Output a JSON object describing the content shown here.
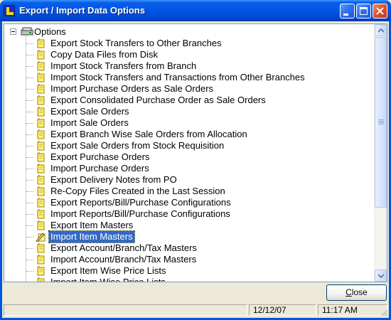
{
  "window": {
    "title": "Export / Import Data Options"
  },
  "tree": {
    "root_label": "Options",
    "items": [
      {
        "label": "Export Stock Transfers to Other Branches"
      },
      {
        "label": "Copy Data Files from Disk"
      },
      {
        "label": "Import Stock Transfers from Branch"
      },
      {
        "label": "Import Stock Transfers and Transactions from Other Branches"
      },
      {
        "label": "Import Purchase Orders as Sale Orders"
      },
      {
        "label": "Export Consolidated Purchase Order as Sale Orders"
      },
      {
        "label": "Export Sale Orders"
      },
      {
        "label": "Import Sale Orders"
      },
      {
        "label": "Export Branch Wise Sale Orders from Allocation"
      },
      {
        "label": "Export Sale Orders from Stock Requisition"
      },
      {
        "label": "Export Purchase Orders"
      },
      {
        "label": "Import Purchase Orders"
      },
      {
        "label": "Export Delivery Notes from PO"
      },
      {
        "label": "Re-Copy Files Created in the Last Session"
      },
      {
        "label": "Export Reports/Bill/Purchase Configurations"
      },
      {
        "label": "Import Reports/Bill/Purchase Configurations"
      },
      {
        "label": "Export Item Masters"
      },
      {
        "label": "Import Item Masters",
        "selected": true
      },
      {
        "label": "Export Account/Branch/Tax Masters"
      },
      {
        "label": "Import Account/Branch/Tax Masters"
      },
      {
        "label": "Export Item Wise Price Lists"
      },
      {
        "label": "Import Item Wise Price Lists"
      }
    ]
  },
  "buttons": {
    "close_accel": "C",
    "close_rest": "lose"
  },
  "status": {
    "panel1": "",
    "date": "12/12/07",
    "time": "11:17 AM"
  },
  "colors": {
    "selection": "#316ac5",
    "titlebar": "#0055e5",
    "face": "#ece9d8"
  },
  "icons": {
    "root": "drive-icon",
    "item": "document-icon",
    "selected_item": "pencil-document-icon"
  }
}
